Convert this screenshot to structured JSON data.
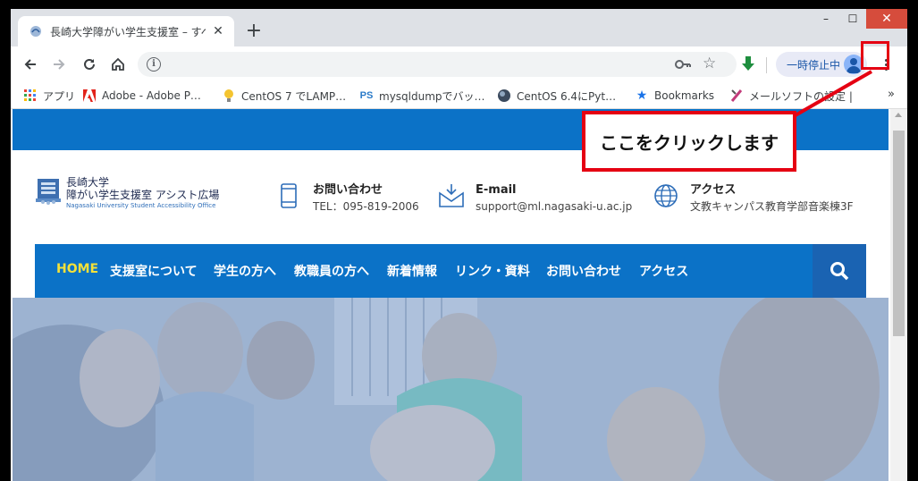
{
  "browser": {
    "tab": {
      "title": "長崎大学障がい学生支援室 – すべ",
      "close": "✕"
    },
    "new_tab": "+",
    "window_controls": {
      "minimize": "–",
      "maximize": "☐",
      "close": "✕"
    },
    "toolbar": {
      "url": "",
      "pause_label": "一時停止中",
      "download_color": "#1e8e3e"
    },
    "bookmarks": [
      {
        "label": "アプリ",
        "icon": "apps-grid-icon"
      },
      {
        "label": "Adobe - Adobe P…",
        "icon": "adobe-icon"
      },
      {
        "label": "CentOS 7 でLAMP…",
        "icon": "lightbulb-icon"
      },
      {
        "label": "mysqldumpでバッ…",
        "icon": "ps-icon"
      },
      {
        "label": "CentOS 6.4にPyt…",
        "icon": "globe-icon"
      },
      {
        "label": "Bookmarks",
        "icon": "star-icon"
      },
      {
        "label": "メールソフトの設定 |",
        "icon": "puzzle-icon"
      }
    ],
    "bookmarks_more": "»"
  },
  "site": {
    "logo": {
      "line1": "長崎大学",
      "line2": "障がい学生支援室 アシスト広場",
      "line3": "Nagasaki University Student Accessibility Office"
    },
    "contact": {
      "title": "お問い合わせ",
      "sub": "TEL：095-819-2006"
    },
    "email": {
      "title": "E-mail",
      "sub": "support@ml.nagasaki-u.ac.jp"
    },
    "access": {
      "title": "アクセス",
      "sub": "文教キャンパス教育学部音楽棟3F"
    },
    "nav": [
      "HOME",
      "支援室について",
      "学生の方へ",
      "教職員の方へ",
      "新着情報",
      "リンク・資料",
      "お問い合わせ",
      "アクセス"
    ],
    "brand_color": "#0b72c7"
  },
  "annotation": {
    "callout_text": "ここをクリックします",
    "color": "#e50012"
  }
}
